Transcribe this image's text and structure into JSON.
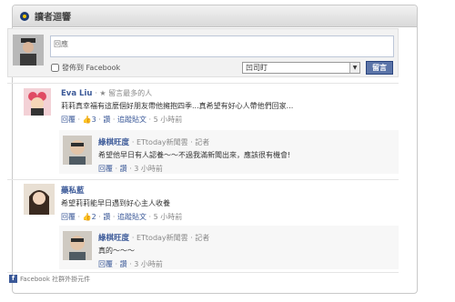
{
  "header": {
    "title": "讀者迴響"
  },
  "composer": {
    "placeholder": "回應",
    "fb_share_label": "發佈到 Facebook",
    "account_select": "凹司盯",
    "post_button": "留言"
  },
  "comments": [
    {
      "author": "Eva Liu",
      "badge": "· ★ 留言最多的人",
      "text": "莉莉真幸福有這麼個好朋友帶他擁抱四季...真希望有好心人帶他們回家...",
      "reply_label": "回覆",
      "likes": "3",
      "like_label": "讚",
      "time": "5 小時前",
      "reply": {
        "author": "綠棋旺度",
        "badge": "· ETtoday新聞雲 · 記者",
        "text": "希望他早日有人認養～～不過我滿新聞出來，應該很有機會!",
        "reply_label": "回覆",
        "like_label": "讚",
        "time": "3 小時前"
      }
    },
    {
      "author": "藥私藍",
      "badge": "",
      "text": "希望莉莉能早日遇到好心主人收養",
      "reply_label": "回覆",
      "likes": "2",
      "like_label": "讚",
      "follow_label": "追蹤貼文",
      "time": "5 小時前",
      "reply": {
        "author": "綠棋旺度",
        "badge": "· ETtoday新聞雲 · 記者",
        "text": "真的～～～",
        "reply_label": "回覆",
        "like_label": "讚",
        "time": "3 小時前"
      }
    }
  ],
  "first_follow_label": "追蹤貼文",
  "footer": {
    "text": "Facebook 社群外掛元件"
  }
}
